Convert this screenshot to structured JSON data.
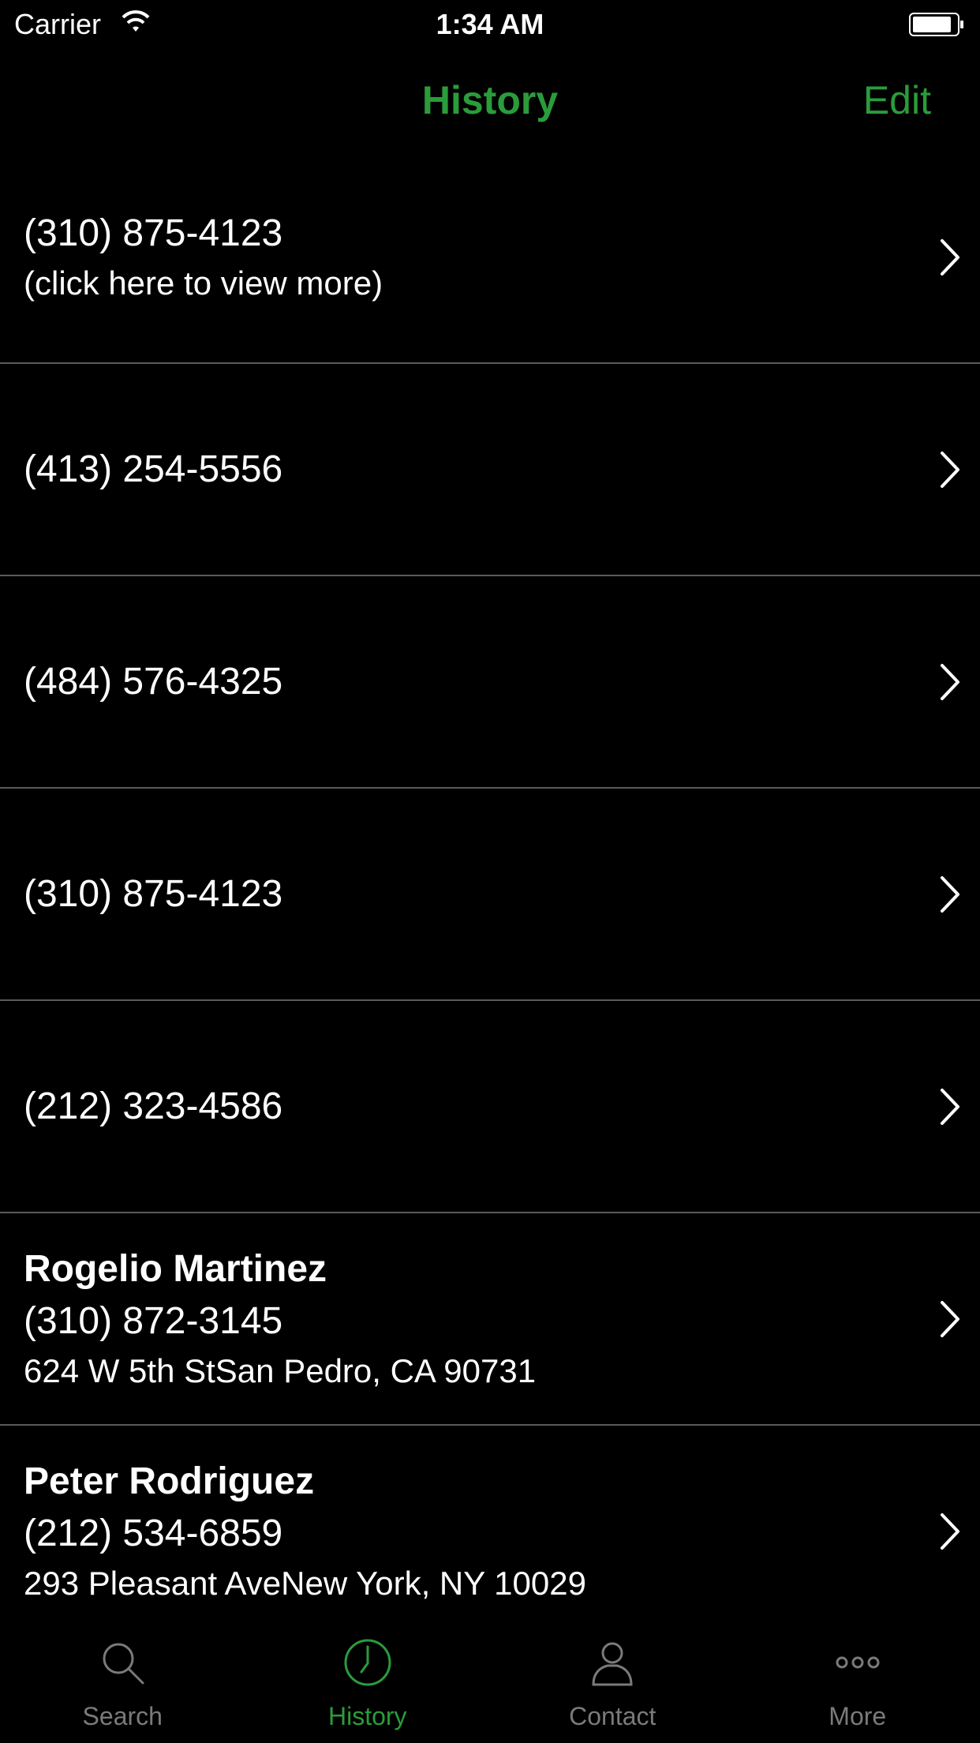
{
  "status_bar": {
    "carrier": "Carrier",
    "time": "1:34 AM"
  },
  "nav": {
    "title": "History",
    "edit_label": "Edit"
  },
  "colors": {
    "accent": "#2a9c3a",
    "background": "#000000",
    "separator": "#5a5a5a",
    "inactive_tab": "#7a7a7a"
  },
  "history": [
    {
      "phone": "(310) 875-4123",
      "note": "(click here to view more)"
    },
    {
      "phone": "(413) 254-5556"
    },
    {
      "phone": "(484) 576-4325"
    },
    {
      "phone": "(310) 875-4123"
    },
    {
      "phone": "(212) 323-4586"
    },
    {
      "name": "Rogelio Martinez",
      "phone": "(310) 872-3145",
      "address": "624 W 5th StSan Pedro, CA 90731"
    },
    {
      "name": "Peter Rodriguez",
      "phone": "(212) 534-6859",
      "address": "293 Pleasant AveNew York, NY 10029"
    }
  ],
  "tabs": [
    {
      "label": "Search",
      "icon": "search-icon",
      "active": false
    },
    {
      "label": "History",
      "icon": "clock-icon",
      "active": true
    },
    {
      "label": "Contact",
      "icon": "person-icon",
      "active": false
    },
    {
      "label": "More",
      "icon": "more-dots-icon",
      "active": false
    }
  ]
}
